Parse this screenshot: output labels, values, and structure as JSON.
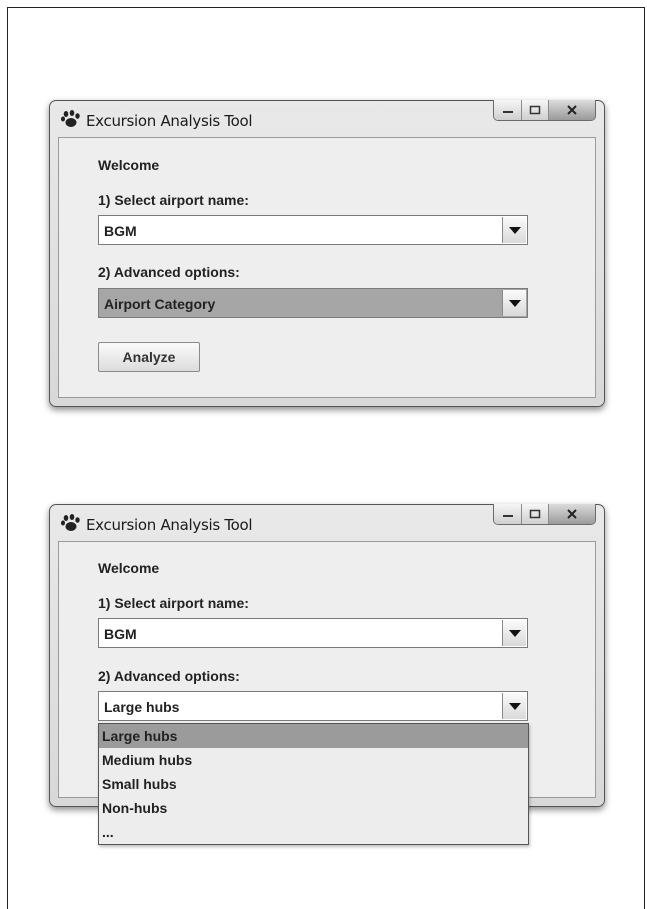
{
  "screens": [
    {
      "window_title": "Excursion Analysis Tool",
      "welcome": "Welcome",
      "airport_label": "1) Select airport name:",
      "airport_value": "BGM",
      "advanced_label": "2) Advanced options:",
      "advanced_value": "Airport Category",
      "analyze_label": "Analyze"
    },
    {
      "window_title": "Excursion Analysis Tool",
      "welcome": "Welcome",
      "airport_label": "1) Select airport name:",
      "airport_value": "BGM",
      "advanced_label": "2) Advanced options:",
      "advanced_value": "Large hubs",
      "dropdown_options": [
        "Large hubs",
        "Medium hubs",
        "Small hubs",
        "Non-hubs",
        "..."
      ],
      "dropdown_highlighted": "Large hubs"
    }
  ],
  "icons": {
    "app": "paw-icon",
    "minimize": "minimize-icon",
    "maximize": "maximize-icon",
    "close": "close-icon",
    "dropdown": "chevron-down-icon"
  }
}
